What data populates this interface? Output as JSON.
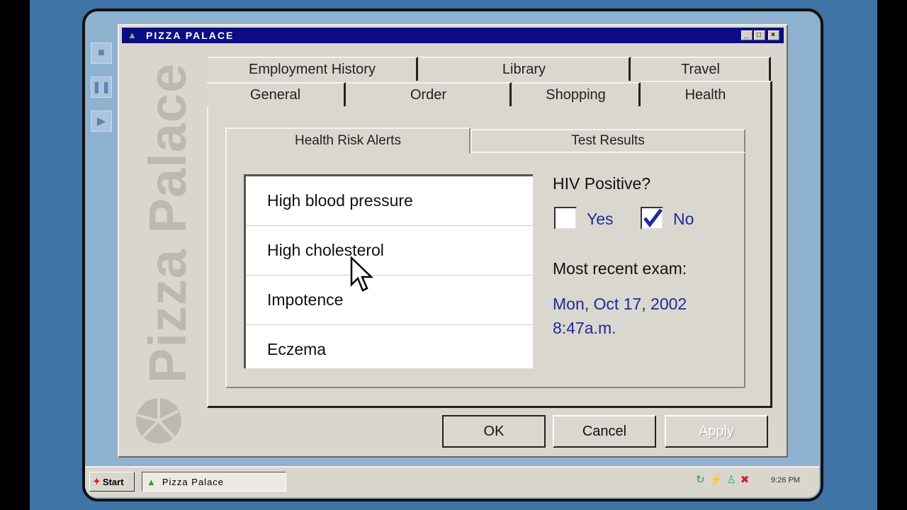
{
  "window": {
    "title": "PIZZA PALACE",
    "brand": "Pizza Palace"
  },
  "tabs_row1": [
    {
      "label": "Employment History"
    },
    {
      "label": "Library"
    },
    {
      "label": "Travel"
    }
  ],
  "tabs_row2": [
    {
      "label": "General"
    },
    {
      "label": "Order"
    },
    {
      "label": "Shopping"
    },
    {
      "label": "Health",
      "active": true
    }
  ],
  "inner_tabs": [
    {
      "label": "Health Risk Alerts",
      "active": true
    },
    {
      "label": "Test Results"
    }
  ],
  "alerts": [
    "High blood pressure",
    "High cholesterol",
    "Impotence",
    "Eczema"
  ],
  "hiv": {
    "label": "HIV Positive?",
    "yes_label": "Yes",
    "yes_checked": false,
    "no_label": "No",
    "no_checked": true
  },
  "exam": {
    "label": "Most recent exam:",
    "date": "Mon, Oct 17, 2002",
    "time": "8:47a.m."
  },
  "buttons": {
    "ok": "OK",
    "cancel": "Cancel",
    "apply": "Apply",
    "apply_disabled": true
  },
  "taskbar": {
    "start": "Start",
    "task": "Pizza Palace",
    "clock": "9:26 PM"
  },
  "colors": {
    "titlebar": "#0c0c86",
    "accent_text": "#1f2a9a"
  }
}
